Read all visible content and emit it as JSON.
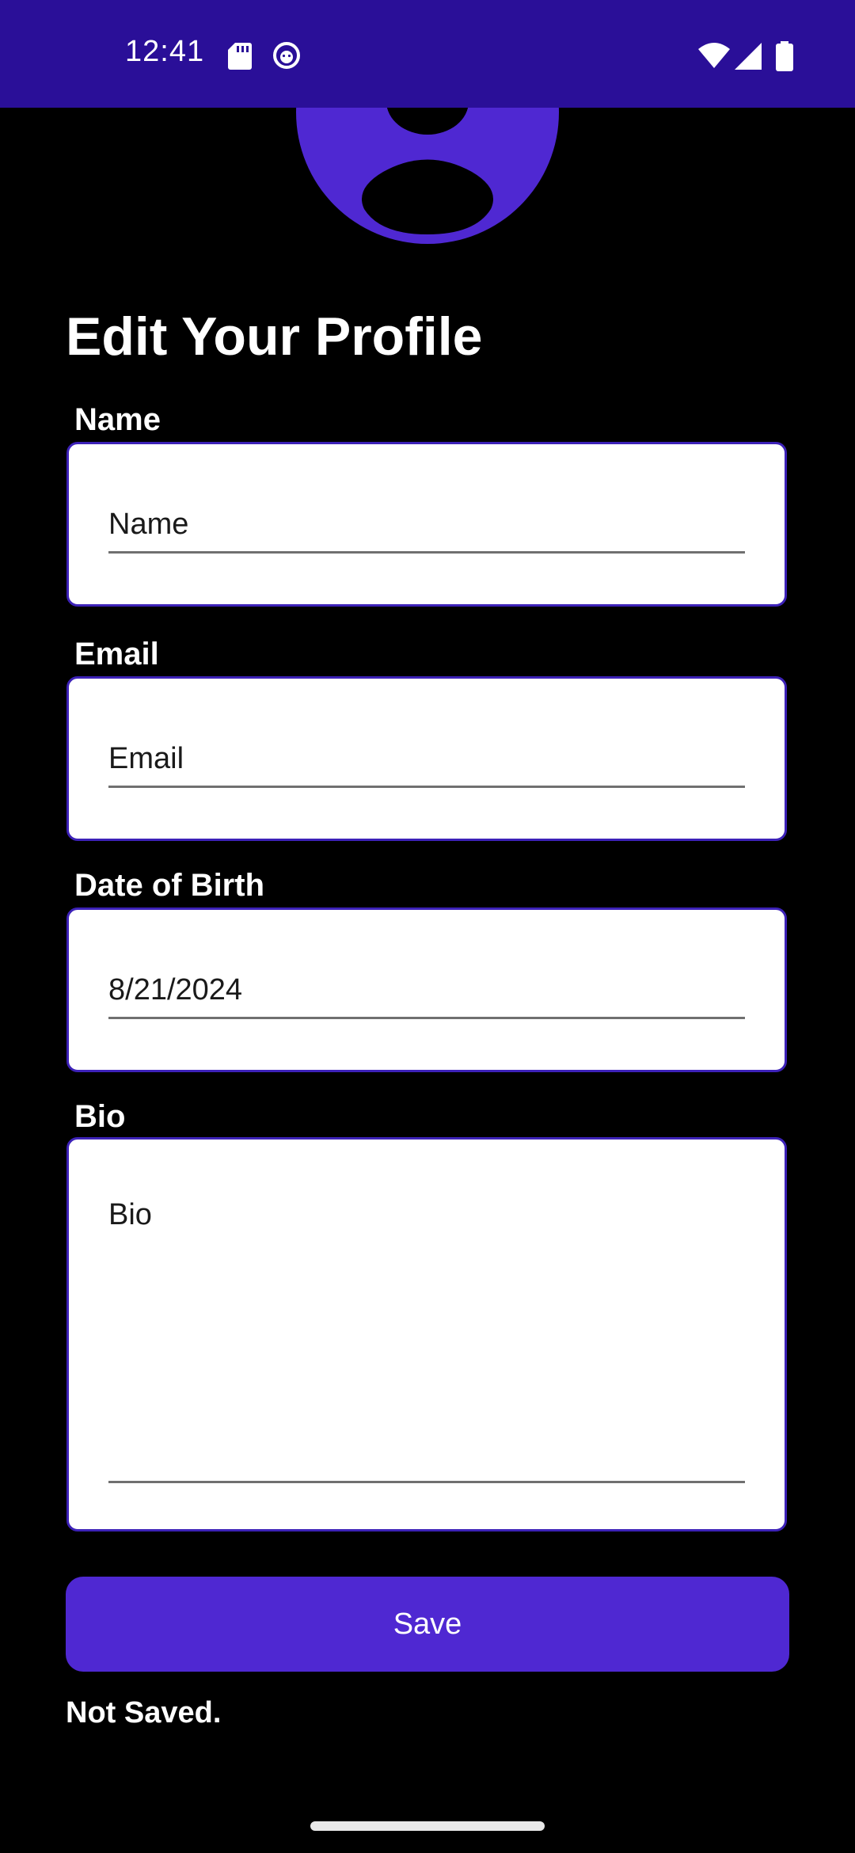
{
  "status_bar": {
    "time": "12:41",
    "icons": [
      "sd-card-icon",
      "face-icon",
      "wifi-icon",
      "cellular-signal-icon",
      "battery-icon"
    ],
    "background": "#2a0f98"
  },
  "profile": {
    "avatar_icon": "person-avatar-icon",
    "title": "Edit Your Profile",
    "fields": {
      "name": {
        "label": "Name",
        "placeholder": "Name",
        "value": ""
      },
      "email": {
        "label": "Email",
        "placeholder": "Email",
        "value": ""
      },
      "dob": {
        "label": "Date of Birth",
        "value": "8/21/2024"
      },
      "bio": {
        "label": "Bio",
        "placeholder": "Bio",
        "value": ""
      }
    },
    "save_label": "Save",
    "save_status": "Not Saved."
  },
  "colors": {
    "accent": "#4f28d2",
    "field_border": "#3d22b8",
    "background": "#000000",
    "field_background": "#ffffff"
  }
}
